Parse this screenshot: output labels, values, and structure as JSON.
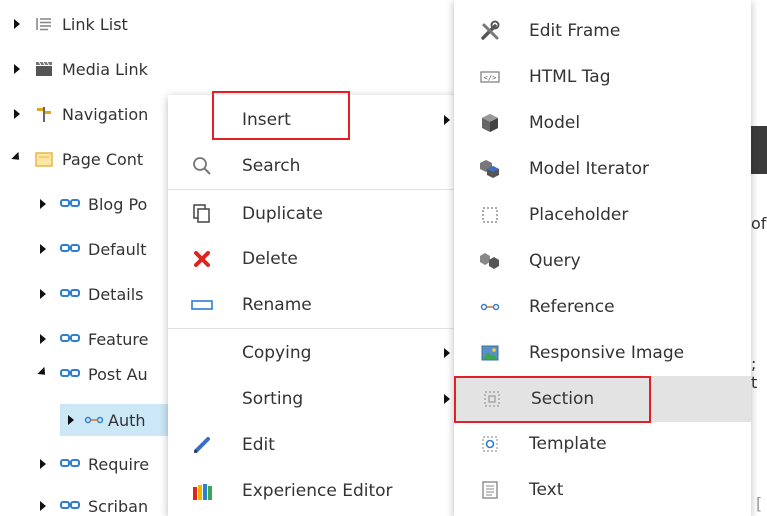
{
  "tree": {
    "items": [
      {
        "label": "Link List",
        "icon": "list-icon",
        "expanded": false
      },
      {
        "label": "Media Link",
        "icon": "media-icon",
        "expanded": false
      },
      {
        "label": "Navigation",
        "icon": "navigation-icon",
        "expanded": false
      },
      {
        "label": "Page Cont",
        "icon": "folder-icon",
        "expanded": true
      },
      {
        "label": "Blog Po",
        "icon": "rendering-icon",
        "expanded": false
      },
      {
        "label": "Default",
        "icon": "rendering-icon",
        "expanded": false
      },
      {
        "label": "Details",
        "icon": "rendering-icon",
        "expanded": false
      },
      {
        "label": "Feature",
        "icon": "rendering-icon",
        "expanded": false
      },
      {
        "label": "Post Au",
        "icon": "rendering-icon",
        "expanded": true
      },
      {
        "label": "Auth",
        "icon": "reference-icon",
        "expanded": false,
        "selected": true
      },
      {
        "label": "Require",
        "icon": "rendering-icon",
        "expanded": false
      },
      {
        "label": "Scriban",
        "icon": "rendering-icon",
        "expanded": false
      }
    ]
  },
  "background_edge": {
    "text1": "of",
    "text2": "; t",
    "text3": "["
  },
  "context_menu": {
    "items": [
      {
        "label": "Insert",
        "icon": "",
        "has_submenu": true,
        "highlighted": true
      },
      {
        "label": "Search",
        "icon": "search-icon",
        "has_submenu": false
      },
      {
        "label": "Duplicate",
        "icon": "duplicate-icon",
        "has_submenu": false
      },
      {
        "label": "Delete",
        "icon": "delete-icon",
        "has_submenu": false
      },
      {
        "label": "Rename",
        "icon": "rename-icon",
        "has_submenu": false
      },
      {
        "label": "Copying",
        "icon": "",
        "has_submenu": true
      },
      {
        "label": "Sorting",
        "icon": "",
        "has_submenu": true
      },
      {
        "label": "Edit",
        "icon": "edit-icon",
        "has_submenu": false
      },
      {
        "label": "Experience Editor",
        "icon": "experience-editor-icon",
        "has_submenu": false
      }
    ]
  },
  "insert_submenu": {
    "items": [
      {
        "label": "Edit Frame",
        "icon": "tools-icon"
      },
      {
        "label": "HTML Tag",
        "icon": "html-tag-icon"
      },
      {
        "label": "Model",
        "icon": "cube-icon"
      },
      {
        "label": "Model Iterator",
        "icon": "cubes-icon"
      },
      {
        "label": "Placeholder",
        "icon": "placeholder-icon"
      },
      {
        "label": "Query",
        "icon": "query-icon"
      },
      {
        "label": "Reference",
        "icon": "reference-icon"
      },
      {
        "label": "Responsive Image",
        "icon": "image-icon"
      },
      {
        "label": "Section",
        "icon": "section-icon",
        "hovered": true,
        "highlighted": true
      },
      {
        "label": "Template",
        "icon": "template-icon"
      },
      {
        "label": "Text",
        "icon": "text-icon"
      }
    ]
  },
  "colors": {
    "highlight_border": "#e31e24",
    "selected_row": "#cce8f7",
    "hover_row": "#e3e3e3",
    "delete_red": "#e0231f",
    "rendering_blue": "#2f7fcf"
  }
}
